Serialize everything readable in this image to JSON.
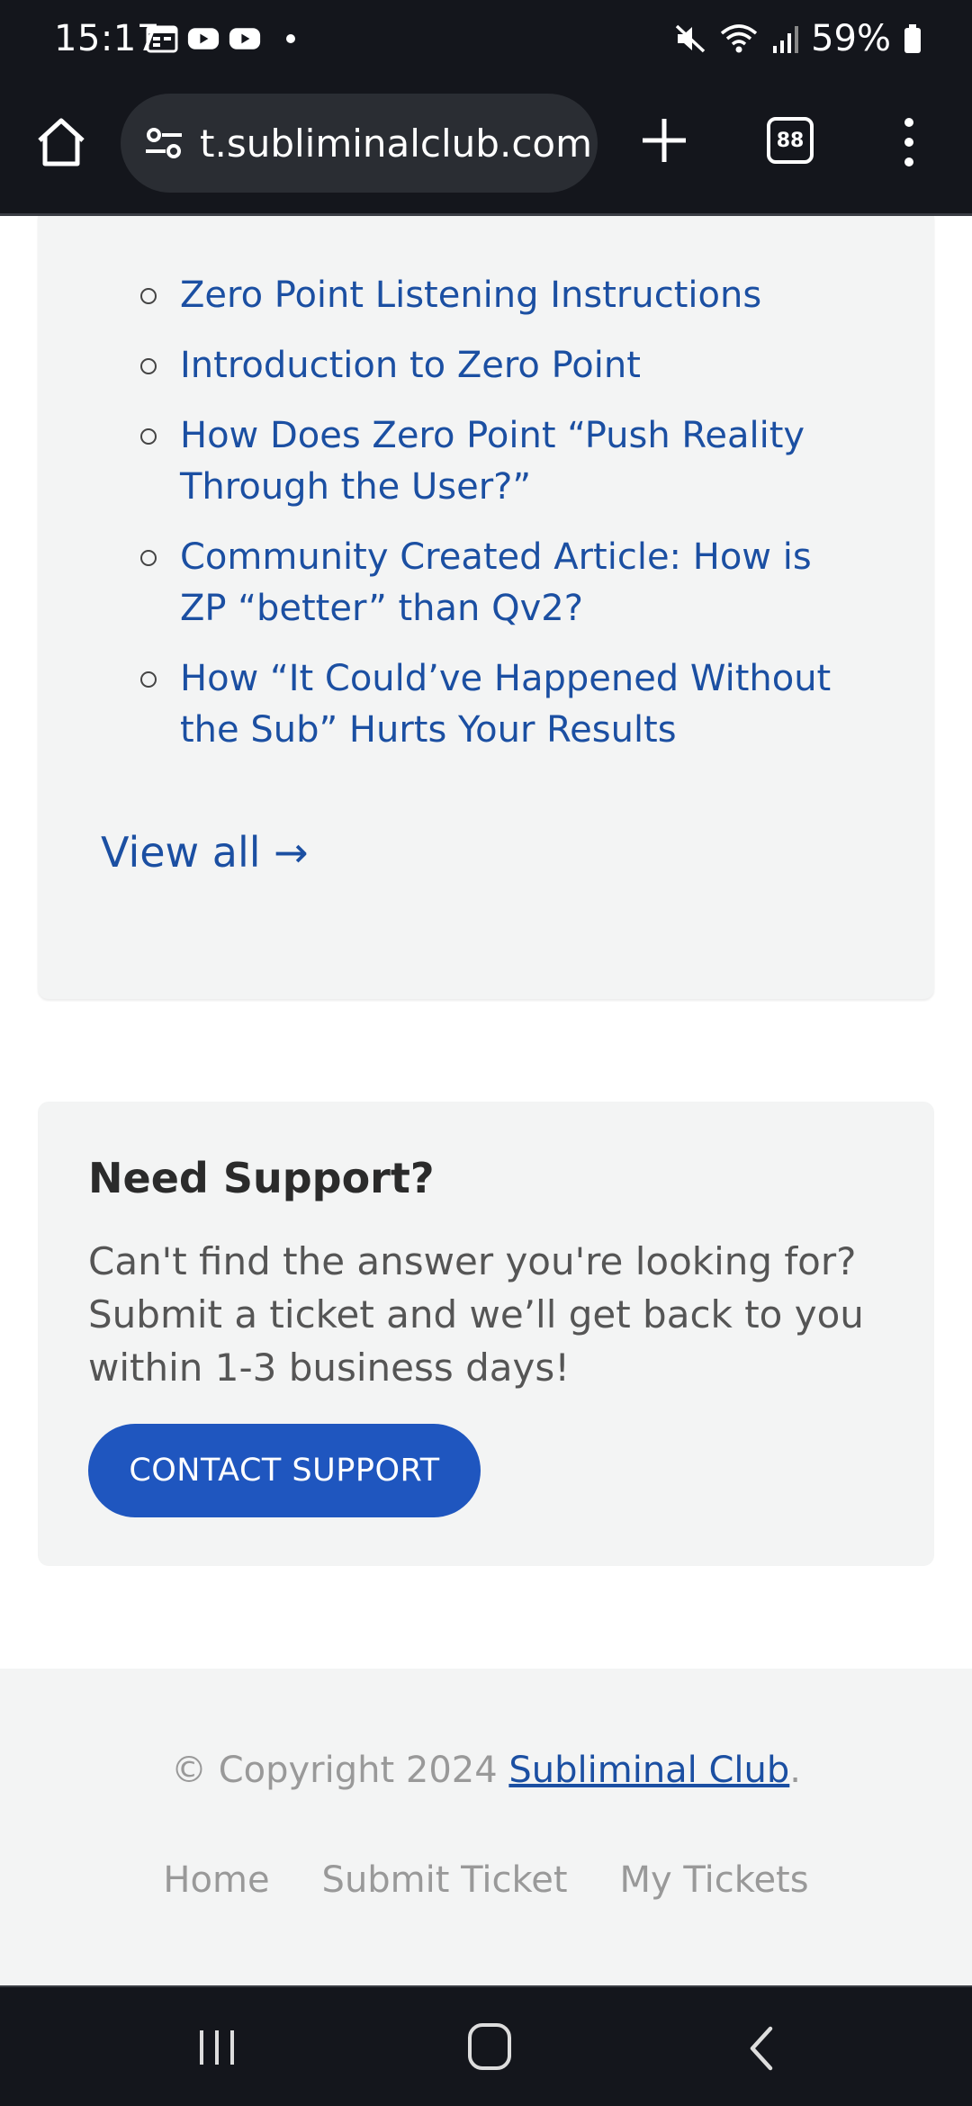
{
  "status_bar": {
    "time": "15:17",
    "battery": "59%",
    "icons": [
      "calendar-icon",
      "youtube-icon",
      "youtube-icon",
      "notification-dot",
      "mute-icon",
      "wifi-icon",
      "signal-icon",
      "battery-icon"
    ]
  },
  "browser": {
    "url": "t.subliminalclub.com",
    "tab_count": "88",
    "icons": [
      "home-icon",
      "site-settings-icon",
      "new-tab-icon",
      "tabs-icon",
      "more-menu-icon"
    ]
  },
  "articles": {
    "items": [
      "Zero Point Listening Instructions",
      "Introduction to Zero Point",
      "How Does Zero Point “Push Reality Through the User?”",
      "Community Created Article: How is ZP “better” than Qv2?",
      "How “It Could’ve Happened Without the Sub” Hurts Your Results"
    ],
    "view_all": "View all →"
  },
  "support": {
    "title": "Need Support?",
    "text": "Can't find the answer you're looking for? Submit a ticket and we’ll get back to you within 1-3 business days!",
    "button": "CONTACT SUPPORT"
  },
  "footer": {
    "copyright_prefix": "© Copyright 2024 ",
    "brand": "Subliminal Club",
    "copyright_suffix": ".",
    "links": [
      "Home",
      "Submit Ticket",
      "My Tickets"
    ]
  },
  "colors": {
    "link": "#1b4fa2",
    "button": "#1f56bf",
    "card_bg": "#f3f4f4",
    "system_bar": "#14161c"
  }
}
